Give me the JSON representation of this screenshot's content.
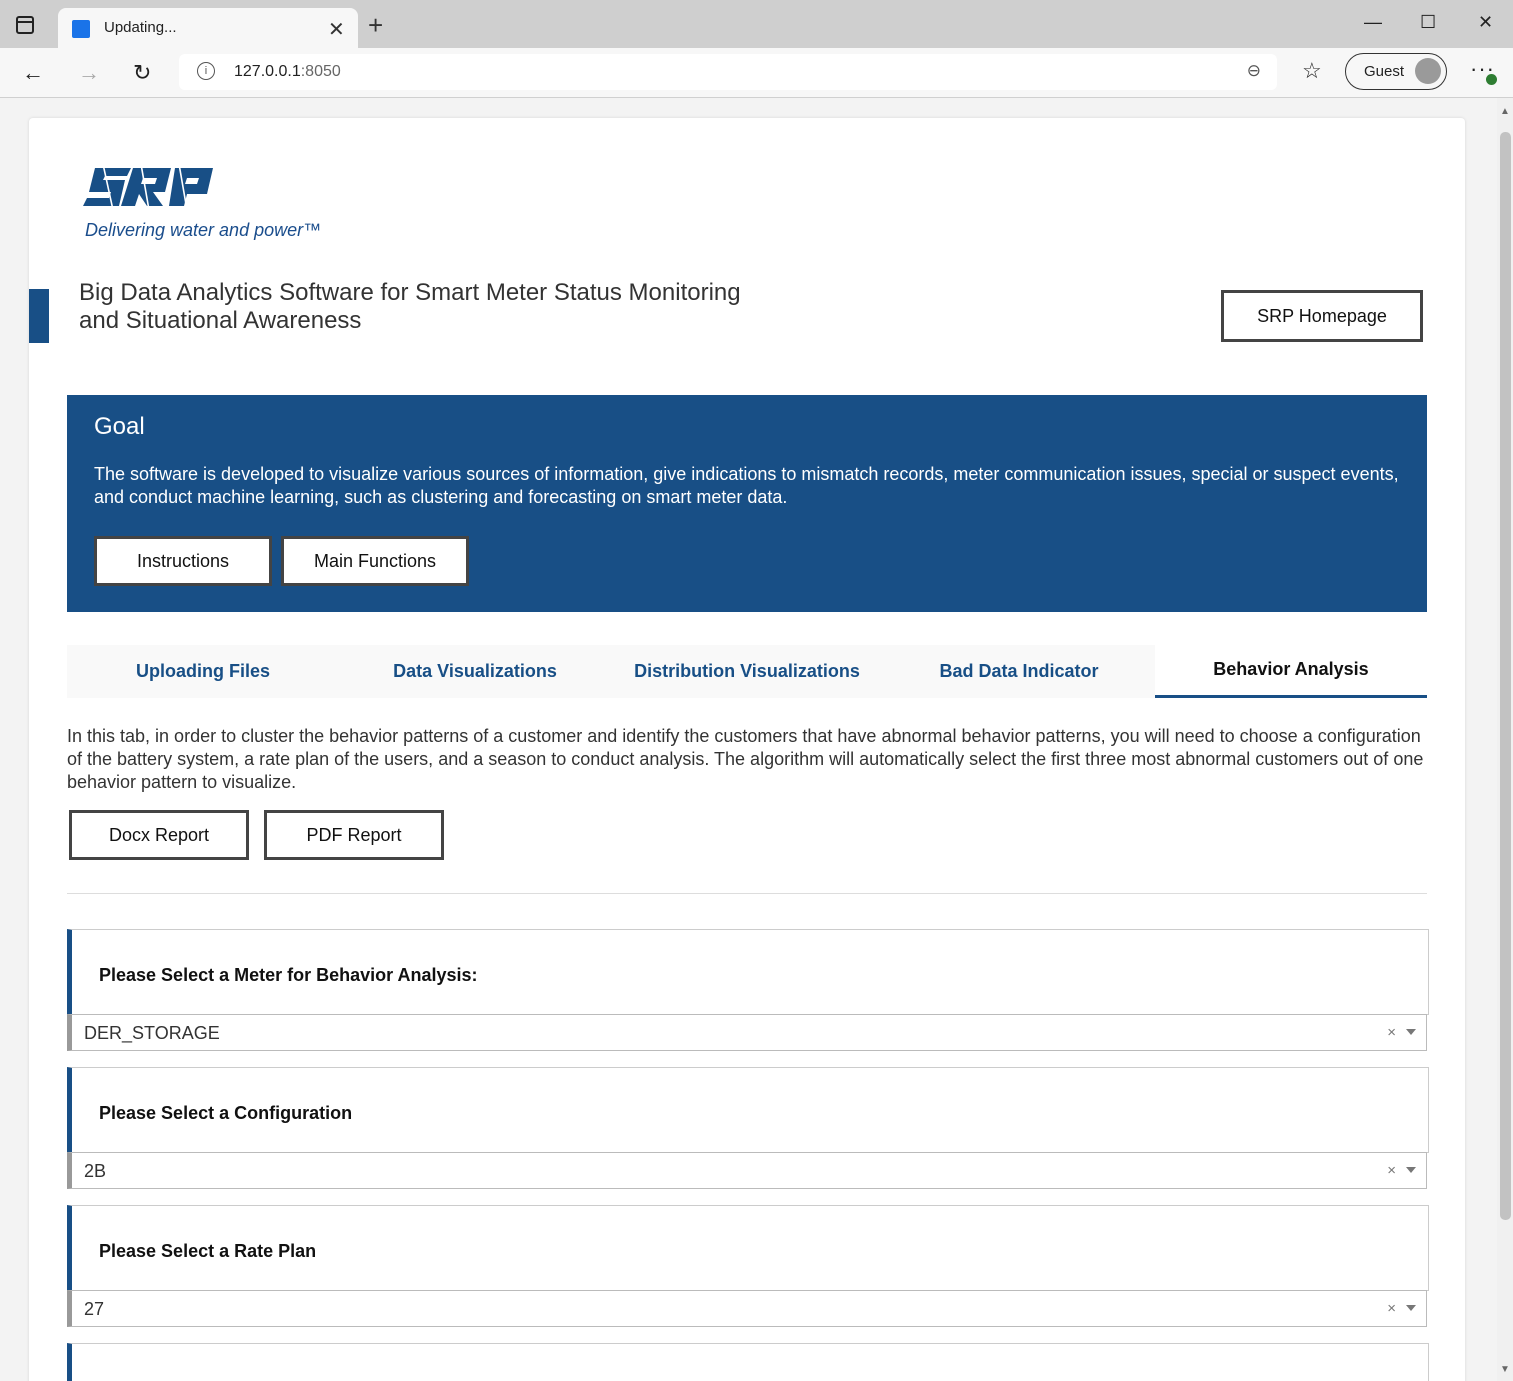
{
  "browser": {
    "tab_title": "Updating...",
    "url_host": "127.0.0.1",
    "url_port": ":8050",
    "profile_label": "Guest"
  },
  "header": {
    "logo_tagline": "Delivering water and power™",
    "title": "Big Data Analytics Software for Smart Meter Status Monitoring and Situational Awareness",
    "home_button": "SRP Homepage"
  },
  "goal": {
    "title": "Goal",
    "text": "The software is developed to visualize various sources of information, give indications to mismatch records, meter communication issues, special or suspect events, and conduct machine learning, such as clustering and forecasting on smart meter data.",
    "buttons": [
      "Instructions",
      "Main Functions"
    ]
  },
  "tabs": [
    {
      "label": "Uploading Files"
    },
    {
      "label": "Data Visualizations"
    },
    {
      "label": "Distribution Visualizations"
    },
    {
      "label": "Bad Data Indicator"
    },
    {
      "label": "Behavior Analysis",
      "active": true
    }
  ],
  "behavior": {
    "intro": "In this tab, in order to cluster the behavior patterns of a customer and identify the customers that have abnormal behavior patterns, you will need to choose a configuration of the battery system, a rate plan of the users, and a season to conduct analysis. The algorithm will automatically select the first three most abnormal customers out of one behavior pattern to visualize.",
    "report_buttons": [
      "Docx Report",
      "PDF Report"
    ],
    "selects": [
      {
        "label": "Please Select a Meter for Behavior Analysis:",
        "value": "DER_STORAGE"
      },
      {
        "label": "Please Select a Configuration",
        "value": "2B"
      },
      {
        "label": "Please Select a Rate Plan",
        "value": "27"
      }
    ],
    "clear_symbol": "×"
  },
  "colors": {
    "brand": "#184f86"
  }
}
